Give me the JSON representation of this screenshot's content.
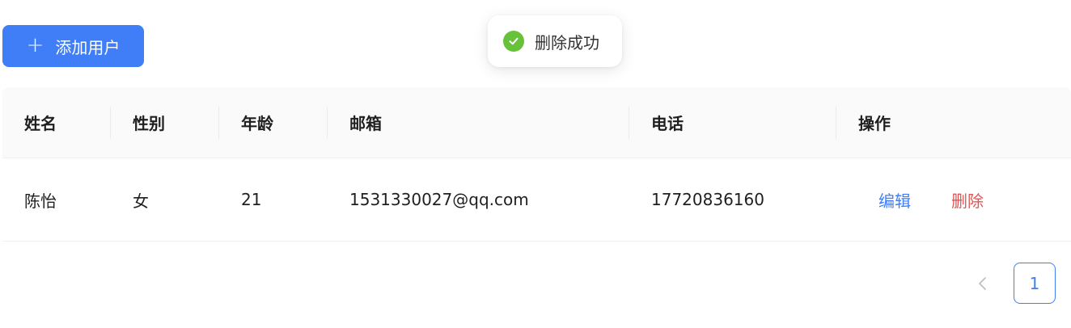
{
  "toolbar": {
    "add_label": "添加用户"
  },
  "toast": {
    "message": "删除成功"
  },
  "table": {
    "columns": [
      "姓名",
      "性别",
      "年龄",
      "邮箱",
      "电话",
      "操作"
    ],
    "rows": [
      {
        "name": "陈怡",
        "gender": "女",
        "age": "21",
        "email": "1531330027@qq.com",
        "phone": "17720836160",
        "edit": "编辑",
        "delete": "删除"
      }
    ]
  },
  "pagination": {
    "current_page": "1"
  },
  "colors": {
    "primary": "#3f7ef7",
    "danger": "#e05555",
    "success": "#67c23a"
  }
}
